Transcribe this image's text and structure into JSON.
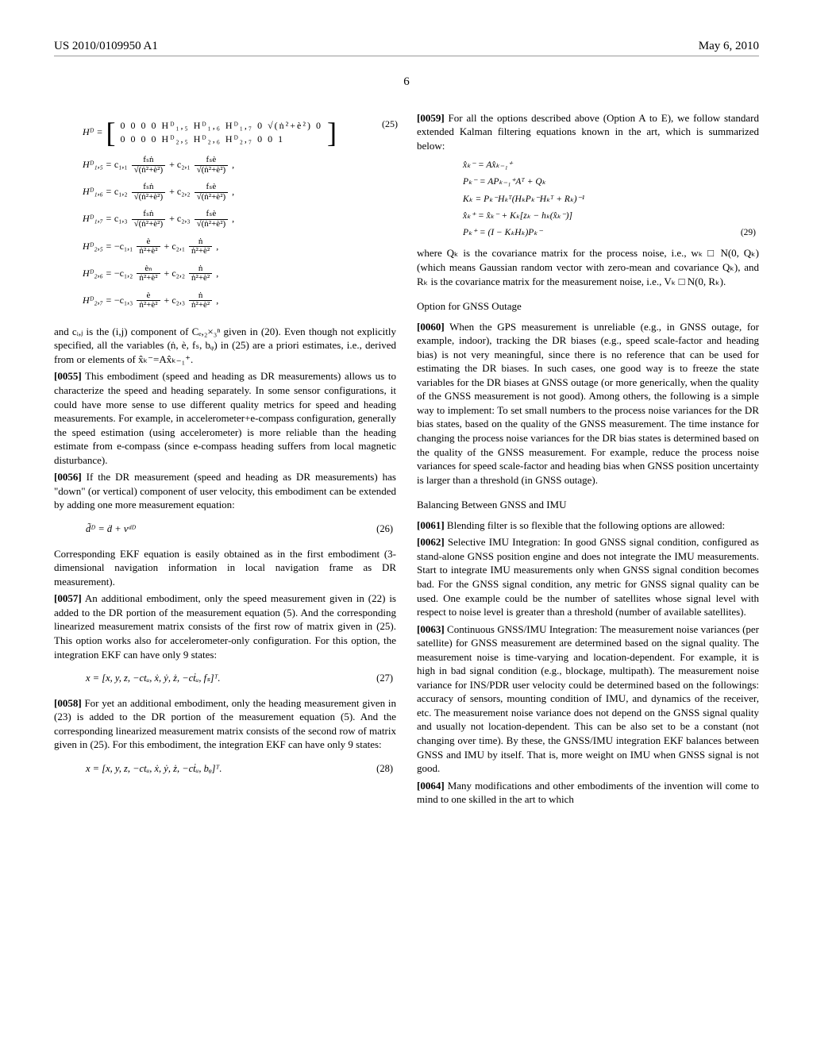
{
  "header": {
    "pub_number": "US 2010/0109950 A1",
    "date": "May 6, 2010"
  },
  "page_number": "6",
  "left": {
    "eq25_label": "(25)",
    "matrix_lhs": "Hᴰ =",
    "matrix_row1": "0  0  0  0   Hᴰ₁,₅  Hᴰ₁,₆  Hᴰ₁,₇   0   √(ṅ²+è²)   0",
    "matrix_row2": "0  0  0  0   Hᴰ₂,₅  Hᴰ₂,₆  Hᴰ₂,₇   0        0        1",
    "h15_lhs": "Hᴰ₁,₅ =",
    "h16_lhs": "Hᴰ₁,₆ =",
    "h17_lhs": "Hᴰ₁,₇ =",
    "h25_lhs": "Hᴰ₂,₅ =",
    "h26_lhs": "Hᴰ₂,₆ =",
    "h27_lhs": "Hᴰ₂,₇ =",
    "c11": "c₁,₁",
    "c12": "c₁,₂",
    "c13": "c₁,₃",
    "c21": "c₂,₁",
    "c22": "c₂,₂",
    "c23": "c₂,₃",
    "fs_n": "fₛṅ",
    "fs_e": "fₛè",
    "frac_den_sqrt": "√(ṅ²+è²)",
    "e_term": "è",
    "en_term": "èₙ",
    "n_term": "ṅ",
    "den_plain": "ṅ²+è²",
    "pre_0055": "and cᵢ,ⱼ is the (i,j) component of Cₑ,₂×₃ⁿ given in (20). Even though not explicitly specified, all the variables (ṅ, è, fₛ, bᵩ) in (25) are a priori estimates, i.e., derived from or elements of x̂ₖ⁻=Ax̂ₖ₋₁⁺.",
    "p0055_num": "[0055]",
    "p0055": "  This embodiment (speed and heading as DR measurements) allows us to characterize the speed and heading separately. In some sensor configurations, it could have more sense to use different quality metrics for speed and heading measurements. For example, in accelerometer+e-compass configuration, generally the speed estimation (using accelerometer) is more reliable than the heading estimate from e-compass (since e-compass heading suffers from local magnetic disturbance).",
    "p0056_num": "[0056]",
    "p0056": "  If the DR measurement (speed and heading as DR measurements) has \"down\" (or vertical) component of user velocity, this embodiment can be extended by adding one more measurement equation:",
    "eq26": "d̃ᴰ = ḋ + vᵈᴰ",
    "eq26_label": "(26)",
    "post_eq26": "Corresponding EKF equation is easily obtained as in the first embodiment (3-dimensional navigation information in local navigation frame as DR measurement).",
    "p0057_num": "[0057]",
    "p0057": "  An additional embodiment, only the speed measurement given in (22) is added to the DR portion of the measurement equation (5). And the corresponding linearized measurement matrix consists of the first row of matrix given in (25). This option works also for accelerometer-only configuration. For this option, the integration EKF can have only 9 states:",
    "eq27": "x = [x, y, z, −ctᵤ, ẋ, ẏ, ż, −cṫᵤ, fₛ]ᵀ.",
    "eq27_label": "(27)",
    "p0058_num": "[0058]",
    "p0058": "  For yet an additional embodiment, only the heading measurement given in (23) is added to the DR portion of the measurement equation (5). And the corresponding linearized measurement matrix consists of the second row of matrix given in (25). For this embodiment, the integration EKF can have only 9 states:",
    "eq28": "x = [x, y, z, −ctᵤ, ẋ, ẏ, ż, −cṫᵤ, bᵩ]ᵀ.",
    "eq28_label": "(28)"
  },
  "right": {
    "p0059_num": "[0059]",
    "p0059": "  For all the options described above (Option A to E), we follow standard extended Kalman filtering equations known in the art, which is summarized below:",
    "eq29_1": "x̂ₖ⁻ = Ax̂ₖ₋₁⁺",
    "eq29_2": "Pₖ⁻ = APₖ₋₁⁺Aᵀ + Qₖ",
    "eq29_3": "Kₖ = Pₖ⁻Hₖᵀ(HₖPₖ⁻Hₖᵀ + Rₖ)⁻¹",
    "eq29_4": "x̂ₖ⁺ = x̂ₖ⁻ + Kₖ[zₖ − hₖ(x̂ₖ⁻)]",
    "eq29_5": "Pₖ⁺ = (I − KₖHₖ)Pₖ⁻",
    "eq29_label": "(29)",
    "post_eq29": "where Qₖ is the covariance matrix for the process noise, i.e., wₖ □ N(0, Qₖ) (which means Gaussian random vector with zero-mean and covariance Qₖ), and Rₖ is the covariance matrix for the measurement noise, i.e., Vₖ □ N(0, Rₖ).",
    "heading_outage": "Option for GNSS Outage",
    "p0060_num": "[0060]",
    "p0060": "  When the GPS measurement is unreliable (e.g., in GNSS outage, for example, indoor), tracking the DR biases (e.g., speed scale-factor and heading bias) is not very meaningful, since there is no reference that can be used for estimating the DR biases. In such cases, one good way is to freeze the state variables for the DR biases at GNSS outage (or more generically, when the quality of the GNSS measurement is not good). Among others, the following is a simple way to implement: To set small numbers to the process noise variances for the DR bias states, based on the quality of the GNSS measurement. The time instance for changing the process noise variances for the DR bias states is determined based on the quality of the GNSS measurement. For example, reduce the process noise variances for speed scale-factor and heading bias when GNSS position uncertainty is larger than a threshold (in GNSS outage).",
    "heading_balance": "Balancing Between GNSS and IMU",
    "p0061_num": "[0061]",
    "p0061": "  Blending filter is so flexible that the following options are allowed:",
    "p0062_num": "[0062]",
    "p0062": "  Selective IMU Integration: In good GNSS signal condition, configured as stand-alone GNSS position engine and does not integrate the IMU measurements. Start to integrate IMU measurements only when GNSS signal condition becomes bad. For the GNSS signal condition, any metric for GNSS signal quality can be used. One example could be the number of satellites whose signal level with respect to noise level is greater than a threshold (number of available satellites).",
    "p0063_num": "[0063]",
    "p0063": "  Continuous GNSS/IMU Integration: The measurement noise variances (per satellite) for GNSS measurement are determined based on the signal quality. The measurement noise is time-varying and location-dependent. For example, it is high in bad signal condition (e.g., blockage, multipath). The measurement noise variance for INS/PDR user velocity could be determined based on the followings: accuracy of sensors, mounting condition of IMU, and dynamics of the receiver, etc. The measurement noise variance does not depend on the GNSS signal quality and usually not location-dependent. This can be also set to be a constant (not changing over time). By these, the GNSS/IMU integration EKF balances between GNSS and IMU by itself. That is, more weight on IMU when GNSS signal is not good.",
    "p0064_num": "[0064]",
    "p0064": "  Many modifications and other embodiments of the invention will come to mind to one skilled in the art to which"
  }
}
